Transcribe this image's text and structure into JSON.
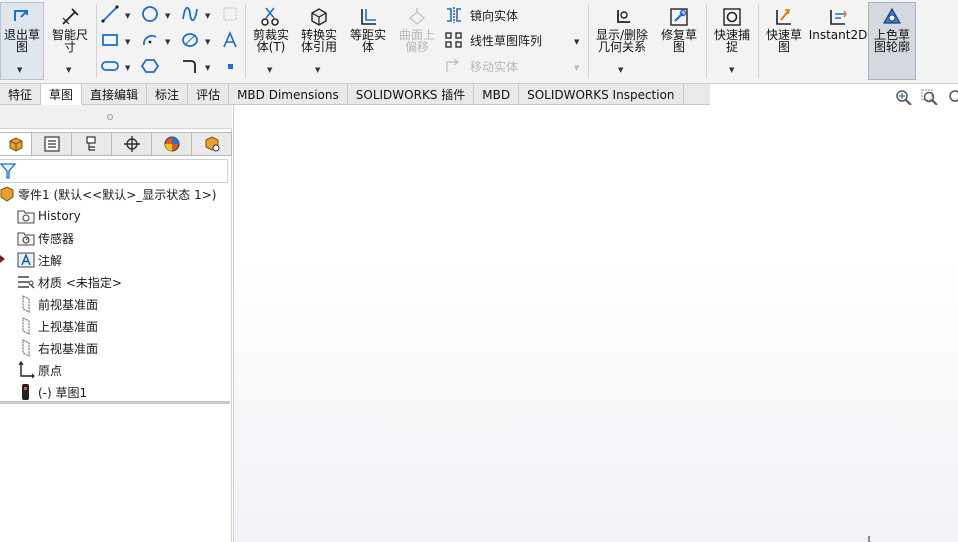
{
  "ribbon": {
    "exit_sketch": "退出草\n图",
    "smart_dimension": "智能尺\n寸",
    "trim_entities": "剪裁实\n体(T)",
    "convert_entities": "转换实\n体引用",
    "offset_entities": "等距实\n体",
    "surface_offset": "曲面上\n偏移",
    "mirror_entities": "镜向实体",
    "linear_sketch_pattern": "线性草图阵列",
    "move_entities": "移动实体",
    "display_delete_relations": "显示/删除\n几何关系",
    "repair_sketch": "修复草\n图",
    "quick_snaps": "快速捕\n捉",
    "rapid_sketch": "快速草\n图",
    "instant2d": "Instant2D",
    "shaded_sketch_contours": "上色草\n图轮廓"
  },
  "tabs": [
    {
      "label": "特征"
    },
    {
      "label": "草图"
    },
    {
      "label": "直接编辑"
    },
    {
      "label": "标注"
    },
    {
      "label": "评估"
    },
    {
      "label": "MBD Dimensions"
    },
    {
      "label": "SOLIDWORKS 插件"
    },
    {
      "label": "MBD"
    },
    {
      "label": "SOLIDWORKS Inspection"
    }
  ],
  "active_tab": "草图",
  "tree": {
    "root": "零件1  (默认<<默认>_显示状态 1>)",
    "items": [
      {
        "label": "History",
        "icon": "history-folder-icon"
      },
      {
        "label": "传感器",
        "icon": "sensors-folder-icon"
      },
      {
        "label": "注解",
        "icon": "annotations-icon"
      },
      {
        "label": "材质 <未指定>",
        "icon": "material-icon"
      },
      {
        "label": "前视基准面",
        "icon": "plane-icon"
      },
      {
        "label": "上视基准面",
        "icon": "plane-icon"
      },
      {
        "label": "右视基准面",
        "icon": "plane-icon"
      },
      {
        "label": "原点",
        "icon": "origin-icon"
      },
      {
        "label": "(-) 草图1",
        "icon": "sketch-icon"
      }
    ]
  },
  "colors": {
    "accent": "#1c6fd1",
    "ribbon_bg": "#f3f3f3",
    "tab_bg": "#e9e9e9"
  }
}
